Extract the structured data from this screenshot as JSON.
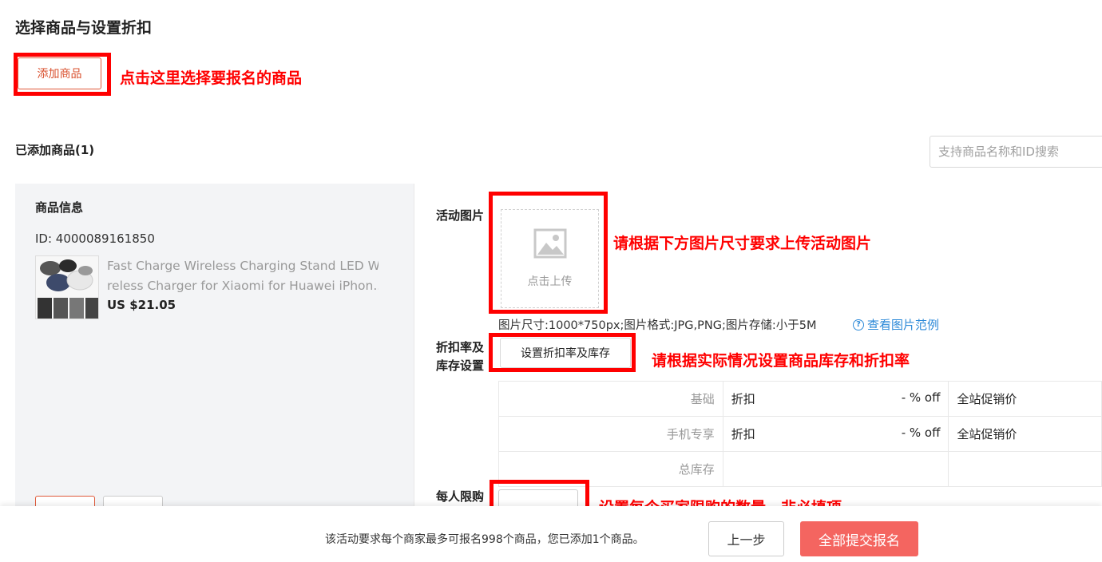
{
  "section_title": "选择商品与设置折扣",
  "add_button": "添加商品",
  "annotations": {
    "add": "点击这里选择要报名的商品",
    "image": "请根据下方图片尺寸要求上传活动图片",
    "discount": "请根据实际情况设置商品库存和折扣率",
    "limit": "设置每个买家限购的数量，非必填项"
  },
  "added_label": "已添加商品(1)",
  "search": {
    "placeholder": "支持商品名称和ID搜索"
  },
  "product": {
    "header": "商品信息",
    "id_text": "ID: 4000089161850",
    "name_line1": "Fast Charge Wireless Charging Stand LED Wi",
    "name_line2": "reless Charger for Xiaomi for Huawei iPhon...",
    "price": "US $21.05"
  },
  "form": {
    "image_label": "活动图片",
    "upload_text": "点击上传",
    "requirements": "图片尺寸:1000*750px;图片格式:JPG,PNG;图片存储:小于5M",
    "example_link": "查看图片范例",
    "discount_label_1": "折扣率及",
    "discount_label_2": "库存设置",
    "discount_button": "设置折扣率及库存",
    "limit_label": "每人限购"
  },
  "discount_table": [
    {
      "label": "基础",
      "type": "折扣",
      "value": "- % off",
      "price": "全站促销价"
    },
    {
      "label": "手机专享",
      "type": "折扣",
      "value": "- % off",
      "price": "全站促销价"
    },
    {
      "label": "总库存",
      "type": "",
      "value": "",
      "price": ""
    }
  ],
  "footer": {
    "notice": "该活动要求每个商家最多可报名998个商品，您已添加1个商品。",
    "prev": "上一步",
    "submit": "全部提交报名"
  },
  "colors": {
    "accent": "#f46560",
    "annotation": "#ff0000",
    "link": "#2d8ad8"
  }
}
